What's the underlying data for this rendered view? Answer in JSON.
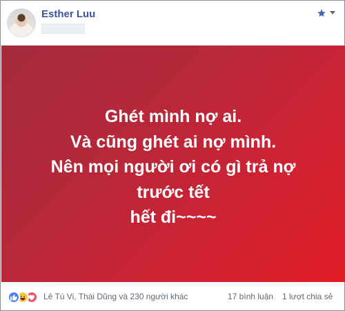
{
  "post": {
    "author_name": "Esther Luu",
    "text_lines": [
      "Ghét mình nợ ai.",
      "Và cũng ghét ai nợ mình.",
      "Nên mọi người ơi có gì trả nợ",
      "trước tết",
      "hết đi~~~~"
    ],
    "background_colors": [
      "#a42b3c",
      "#e11d26"
    ]
  },
  "footer": {
    "reaction_icons": [
      "like-icon",
      "haha-icon",
      "love-icon"
    ],
    "likers_text": "Lê Tú Vi, Thái Dũng và 230 người khác",
    "comments_text": "17 bình luận",
    "shares_text": "1 lượt chia sẻ"
  },
  "colors": {
    "author_link": "#365899",
    "meta_text": "#606770",
    "like_blue": "#4f7ef5",
    "haha_yellow": "#f7c946",
    "love_red": "#f25268"
  }
}
